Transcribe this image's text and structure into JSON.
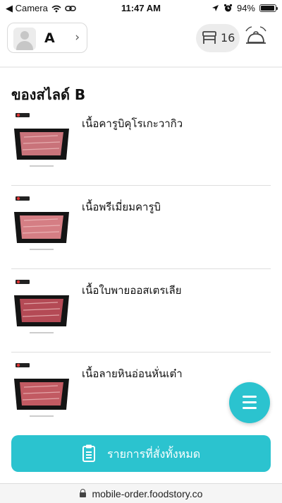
{
  "status_bar": {
    "back_app": "◀ Camera",
    "time": "11:47 AM",
    "battery_pct": "94%",
    "battery_level": 0.94
  },
  "header": {
    "profile_initial": "A",
    "table_number": "16"
  },
  "section": {
    "title": "ของสไลด์ B",
    "items": [
      {
        "name": "เนื้อคารูบิคุโรเกะวากิว",
        "meat_color": "#c9737a"
      },
      {
        "name": "เนื้อพรีเมี่ยมคารูบิ",
        "meat_color": "#d57e84"
      },
      {
        "name": "เนื้อใบพายออสเตรเลีย",
        "meat_color": "#b44a55"
      },
      {
        "name": "เนื้อลายหินอ่อนหั่นเต๋า",
        "meat_color": "#c25a62"
      }
    ]
  },
  "order_bar": {
    "label": "รายการที่สั่งทั้งหมด"
  },
  "url_bar": {
    "url": "mobile-order.foodstory.co"
  },
  "colors": {
    "accent": "#2bc3cf"
  }
}
